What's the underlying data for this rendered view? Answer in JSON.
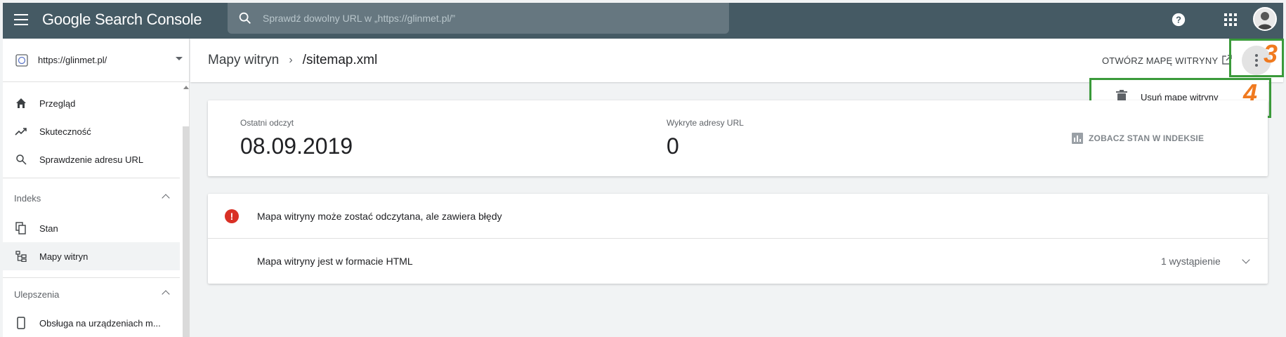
{
  "topbar": {
    "app_title": "Google Search Console",
    "search_placeholder": "Sprawdź dowolny URL w „https://glinmet.pl/”"
  },
  "sidebar": {
    "property": "https://glinmet.pl/",
    "items": [
      {
        "label": "Przegląd",
        "icon": "home-icon"
      },
      {
        "label": "Skuteczność",
        "icon": "trending-up-icon"
      },
      {
        "label": "Sprawdzenie adresu URL",
        "icon": "search-icon"
      }
    ],
    "sections": [
      {
        "title": "Indeks",
        "items": [
          {
            "label": "Stan",
            "icon": "copy-icon"
          },
          {
            "label": "Mapy witryn",
            "icon": "sitemap-icon"
          }
        ]
      },
      {
        "title": "Ulepszenia",
        "items": [
          {
            "label": "Obsługa na urządzeniach m...",
            "icon": "phone-icon"
          }
        ]
      }
    ]
  },
  "header": {
    "breadcrumb_parent": "Mapy witryn",
    "breadcrumb_current": "/sitemap.xml",
    "open_sitemap_label": "OTWÓRZ MAPĘ WITRYNY"
  },
  "menu": {
    "delete_label": "Usuń mapę witryny"
  },
  "annotations": {
    "step3": "3",
    "step4": "4"
  },
  "stats": {
    "last_read_label": "Ostatni odczyt",
    "last_read_value": "08.09.2019",
    "discovered_label": "Wykryte adresy URL",
    "discovered_value": "0",
    "index_link_label": "ZOBACZ STAN W INDEKSIE"
  },
  "issues": {
    "error_message": "Mapa witryny może zostać odczytana, ale zawiera błędy",
    "detail_message": "Mapa witryny jest w formacie HTML",
    "occurrences": "1 wystąpienie"
  },
  "colors": {
    "topbar": "#455a64",
    "annotation_box": "#3a9a3a",
    "annotation_number": "#f07a1f",
    "error": "#d93025"
  }
}
